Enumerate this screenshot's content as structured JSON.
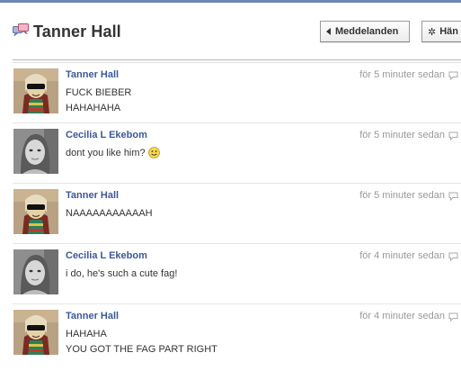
{
  "header": {
    "title": "Tanner Hall",
    "messages_button": "Meddelanden",
    "actions_button": "Hän"
  },
  "colors": {
    "accent": "#3b5998",
    "topbar": "#6d84b4",
    "timestamp": "#999999"
  },
  "messages": [
    {
      "sender": "Tanner Hall",
      "time": "för 5 minuter sedan",
      "avatar": "tanner-hall-avatar",
      "lines": [
        "FUCK BIEBER",
        "HAHAHAHA"
      ],
      "emoji": ""
    },
    {
      "sender": "Cecilia L Ekebom",
      "time": "för 5 minuter sedan",
      "avatar": "cecilia-ekebom-avatar",
      "lines": [
        "dont you like him?"
      ],
      "emoji": "smiley-icon"
    },
    {
      "sender": "Tanner Hall",
      "time": "för 5 minuter sedan",
      "avatar": "tanner-hall-avatar",
      "lines": [
        "NAAAAAAAAAAAH"
      ],
      "emoji": ""
    },
    {
      "sender": "Cecilia L Ekebom",
      "time": "för 4 minuter sedan",
      "avatar": "cecilia-ekebom-avatar",
      "lines": [
        "i do, he's such a cute fag!"
      ],
      "emoji": ""
    },
    {
      "sender": "Tanner Hall",
      "time": "för 4 minuter sedan",
      "avatar": "tanner-hall-avatar",
      "lines": [
        "HAHAHA",
        "YOU GOT THE FAG PART RIGHT"
      ],
      "emoji": ""
    }
  ]
}
